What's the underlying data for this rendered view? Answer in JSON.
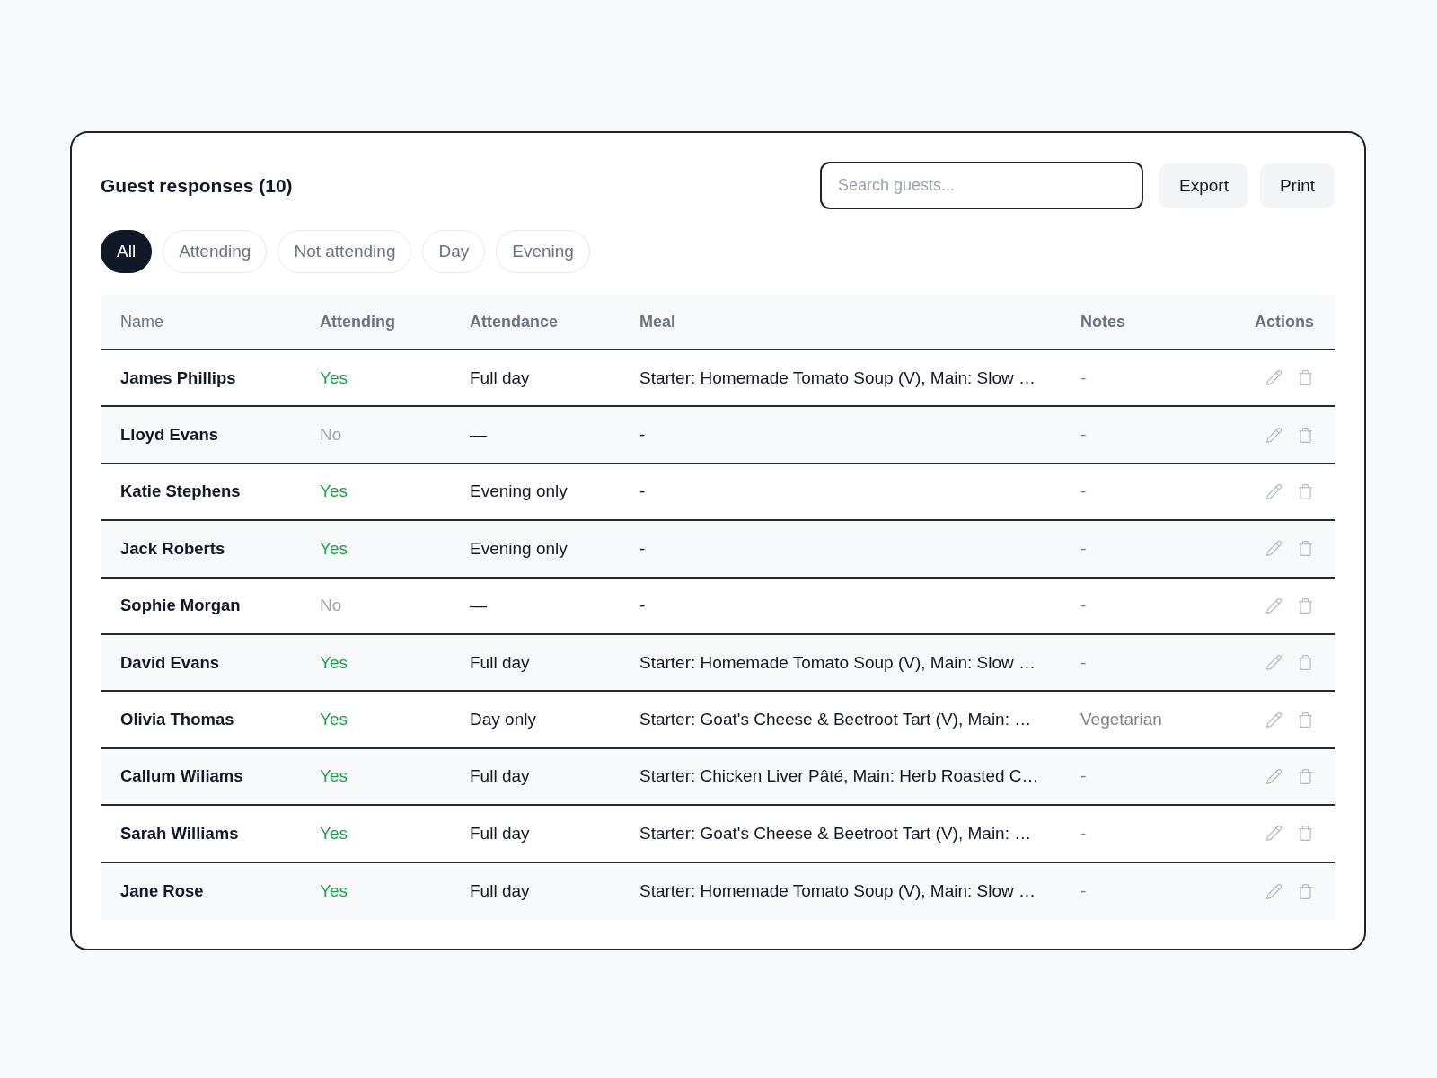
{
  "title": "Guest responses (10)",
  "search": {
    "placeholder": "Search guests..."
  },
  "buttons": [
    "Export",
    "Print"
  ],
  "filters": [
    {
      "label": "All",
      "selected": true
    },
    {
      "label": "Attending",
      "selected": false
    },
    {
      "label": "Not attending",
      "selected": false
    },
    {
      "label": "Day",
      "selected": false
    },
    {
      "label": "Evening",
      "selected": false
    }
  ],
  "table": {
    "columns": [
      {
        "label": "Name",
        "kind": "plain"
      },
      {
        "label": "Attending",
        "kind": "strong"
      },
      {
        "label": "Attendance",
        "kind": "strong"
      },
      {
        "label": "Meal",
        "kind": "strong"
      },
      {
        "label": "Notes",
        "kind": "strong"
      },
      {
        "label": "Actions",
        "kind": "strong"
      }
    ],
    "rows": [
      {
        "name": "James Phillips",
        "attending": {
          "text": "Yes",
          "confirmed": true
        },
        "attendance": "Full day",
        "meal": "Starter: Homemade Tomato Soup (V), Main: Slow …",
        "notes": "-"
      },
      {
        "name": "Lloyd Evans",
        "attending": {
          "text": "No",
          "confirmed": false
        },
        "attendance": "—",
        "meal": "-",
        "notes": "-"
      },
      {
        "name": "Katie Stephens",
        "attending": {
          "text": "Yes",
          "confirmed": true
        },
        "attendance": "Evening only",
        "meal": "-",
        "notes": "-"
      },
      {
        "name": "Jack Roberts",
        "attending": {
          "text": "Yes",
          "confirmed": true
        },
        "attendance": "Evening only",
        "meal": "-",
        "notes": "-"
      },
      {
        "name": "Sophie Morgan",
        "attending": {
          "text": "No",
          "confirmed": false
        },
        "attendance": "—",
        "meal": "-",
        "notes": "-"
      },
      {
        "name": "David Evans",
        "attending": {
          "text": "Yes",
          "confirmed": true
        },
        "attendance": "Full day",
        "meal": "Starter: Homemade Tomato Soup (V), Main: Slow …",
        "notes": "-"
      },
      {
        "name": "Olivia Thomas",
        "attending": {
          "text": "Yes",
          "confirmed": true
        },
        "attendance": "Day only",
        "meal": "Starter: Goat's Cheese & Beetroot Tart (V), Main: …",
        "notes": "Vegetarian"
      },
      {
        "name": "Callum Wiliams",
        "attending": {
          "text": "Yes",
          "confirmed": true
        },
        "attendance": "Full day",
        "meal": "Starter: Chicken Liver Pâté, Main: Herb Roasted C…",
        "notes": "-"
      },
      {
        "name": "Sarah Williams",
        "attending": {
          "text": "Yes",
          "confirmed": true
        },
        "attendance": "Full day",
        "meal": "Starter: Goat's Cheese & Beetroot Tart (V), Main: …",
        "notes": "-"
      },
      {
        "name": "Jane Rose",
        "attending": {
          "text": "Yes",
          "confirmed": true
        },
        "attendance": "Full day",
        "meal": "Starter: Homemade Tomato Soup (V), Main: Slow …",
        "notes": "-"
      }
    ]
  }
}
